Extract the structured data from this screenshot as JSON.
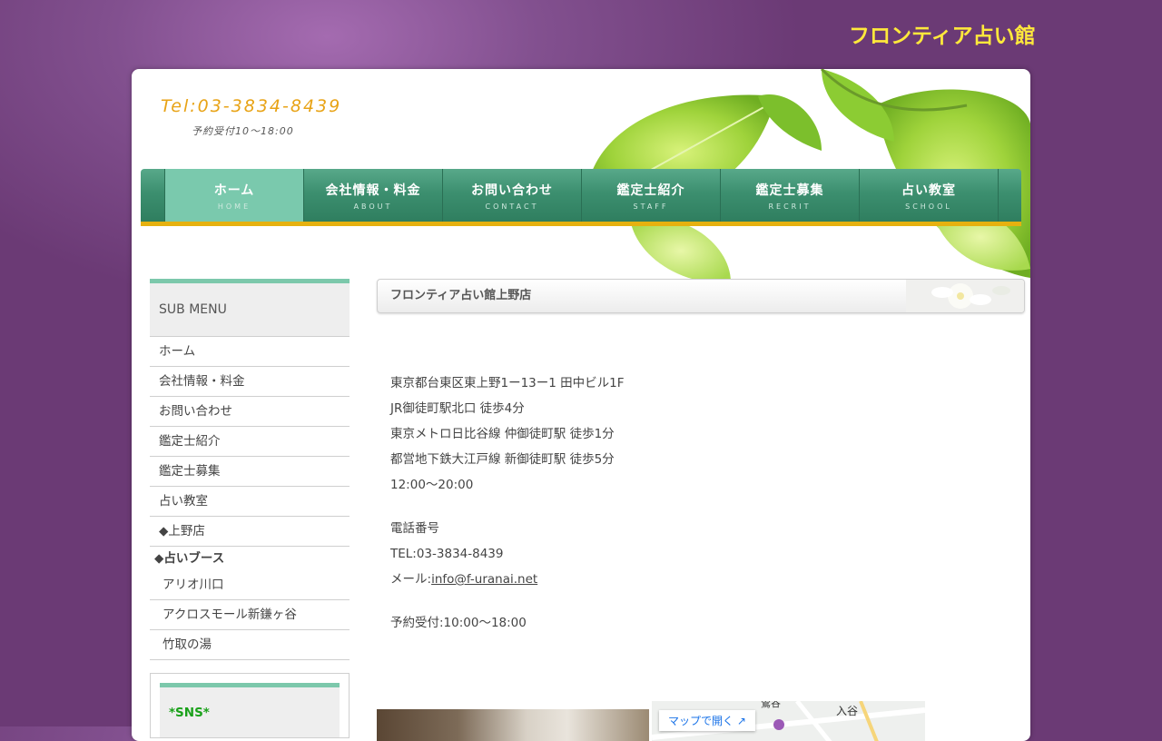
{
  "site_title": "フロンティア占い館",
  "header": {
    "tel": "Tel:03-3834-8439",
    "tel_sub": "予約受付10～18:00"
  },
  "nav": [
    {
      "label": "ホーム",
      "sub": "HOME",
      "active": true
    },
    {
      "label": "会社情報・料金",
      "sub": "ABOUT"
    },
    {
      "label": "お問い合わせ",
      "sub": "CONTACT"
    },
    {
      "label": "鑑定士紹介",
      "sub": "STAFF"
    },
    {
      "label": "鑑定士募集",
      "sub": "RECRIT"
    },
    {
      "label": "占い教室",
      "sub": "SCHOOL"
    }
  ],
  "sidebar": {
    "heading": "SUB MENU",
    "items": [
      "ホーム",
      "会社情報・料金",
      "お問い合わせ",
      "鑑定士紹介",
      "鑑定士募集",
      "占い教室",
      "◆上野店"
    ],
    "group_heading": "◆占いブース",
    "group_items": [
      "アリオ川口",
      "アクロスモール新鎌ヶ谷",
      "竹取の湯"
    ],
    "sns_heading": "*SNS*"
  },
  "content": {
    "title": "フロンティア占い館上野店",
    "address_lines": [
      "東京都台東区東上野1ー13ー1 田中ビル1F",
      "JR御徒町駅北口 徒歩4分",
      "東京メトロ日比谷線 仲御徒町駅 徒歩1分",
      "都営地下鉄大江戸線 新御徒町駅 徒歩5分",
      "12:00〜20:00"
    ],
    "phone_heading": "電話番号",
    "phone": "TEL:03-3834-8439",
    "mail_label": "メール:",
    "mail": "info@f-uranai.net",
    "reservation": "予約受付:10:00〜18:00",
    "map_button": "マップで開く ↗",
    "map_label_1": "入谷",
    "map_label_2": "鶯谷"
  },
  "colors": {
    "background": "#6b3a75",
    "title": "#ffe93b",
    "nav": "#3c8f6f",
    "nav_active": "#7ac9ad",
    "accent_bar": "#e6b10f",
    "tel": "#e8a316"
  }
}
